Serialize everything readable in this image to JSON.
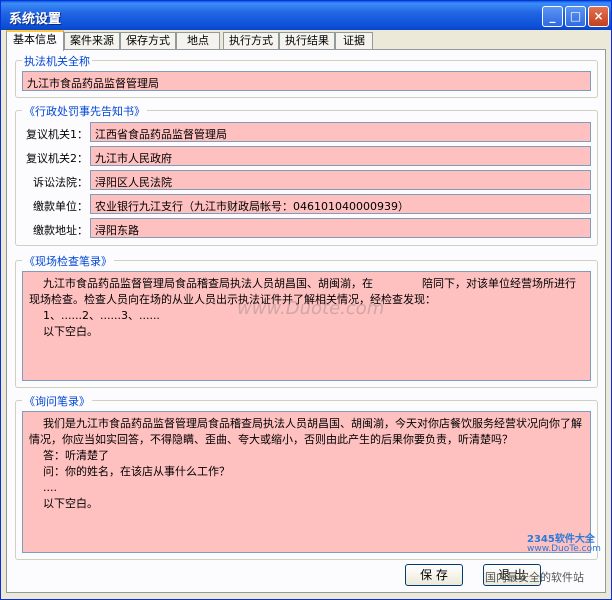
{
  "window": {
    "title": "系统设置"
  },
  "titlebar": {
    "minimize": "_",
    "maximize": "□",
    "close": "×"
  },
  "tabs": [
    "基本信息",
    "案件来源",
    "保存方式",
    "地点",
    "执行方式",
    "执行结果",
    "证据"
  ],
  "agency": {
    "group_label": "执法机关全称",
    "value": "九江市食品药品监督管理局"
  },
  "notice": {
    "group_label": "《行政处罚事先告知书》",
    "fields": [
      {
        "label": "复议机关1：",
        "value": "江西省食品药品监督管理局"
      },
      {
        "label": "复议机关2：",
        "value": "九江市人民政府"
      },
      {
        "label": "诉讼法院：",
        "value": "浔阳区人民法院"
      },
      {
        "label": "缴款单位：",
        "value": "农业银行九江支行（九江市财政局帐号：046101040000939）"
      },
      {
        "label": "缴款地址：",
        "value": "浔阳东路"
      }
    ]
  },
  "inspection": {
    "group_label": "《现场检查笔录》",
    "lines": [
      "    九江市食品药品监督管理局食品稽查局执法人员胡昌国、胡闽湔，在              陪同下，对该单位经营场所进行现场检查。检查人员向在场的从业人员出示执法证件并了解相关情况，经检查发现：",
      "    1、......2、......3、......",
      "    以下空白。"
    ]
  },
  "inquiry": {
    "group_label": "《询问笔录》",
    "lines": [
      "    我们是九江市食品药品监督管理局食品稽查局执法人员胡昌国、胡闽湔，今天对你店餐饮服务经营状况向你了解情况，你应当如实回答，不得隐瞒、歪曲、夸大或缩小，否则由此产生的后果你要负责，听清楚吗？",
      "    答：听清楚了",
      "    问：你的姓名，在该店从事什么工作？",
      "    ....",
      "    以下空白。"
    ]
  },
  "buttons": {
    "save": "保 存",
    "exit": "退 出"
  },
  "watermarks": {
    "center": "www.Duote.com",
    "bottom_right": "2345软件大全",
    "bottom_right_2": "www.DuoTe.com",
    "bottom_right_3": "国内最安全的软件站"
  }
}
